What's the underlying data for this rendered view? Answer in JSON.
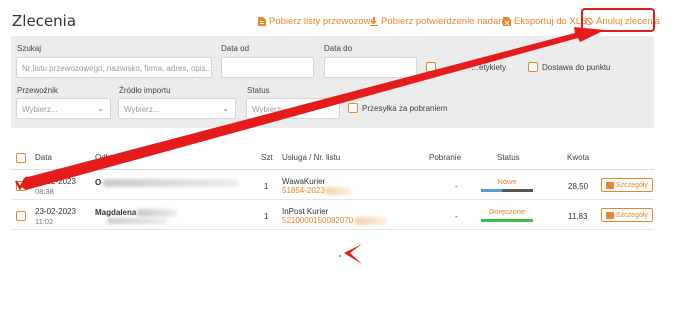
{
  "page": {
    "title": "Zlecenia"
  },
  "actions": [
    {
      "label": "Pobierz listy przewozowe",
      "icon": "file-pdf-icon"
    },
    {
      "label": "Pobierz potwierdzenie nadania",
      "icon": "download-icon"
    },
    {
      "label": "Eksportuj do XLS",
      "icon": "file-excel-icon"
    },
    {
      "label": "Anuluj zlecenia",
      "icon": "ban-icon"
    }
  ],
  "filters": {
    "search": {
      "label": "Szukaj",
      "placeholder": "Nr listu przewozowego, nazwisko, firma, adres, opis..."
    },
    "date_from": {
      "label": "Data od",
      "value": ""
    },
    "date_to": {
      "label": "Data do",
      "value": ""
    },
    "labels_checkbox": "…etykiety",
    "point_checkbox": "Dostawa do punktu",
    "carrier": {
      "label": "Przewoźnik",
      "placeholder": "Wybierz..."
    },
    "source": {
      "label": "Źródło importu",
      "placeholder": "Wybierz..."
    },
    "status": {
      "label": "Status",
      "placeholder": "Wybierz..."
    },
    "cod_checkbox": "Przesyłka za pobraniem"
  },
  "table": {
    "headers": {
      "date": "Data",
      "sender": "Odbiorca",
      "qty": "Szt",
      "service": "Usługa / Nr. listu",
      "cod": "Pobranie",
      "status": "Status",
      "amount": "Kwota"
    },
    "rows": [
      {
        "date": "24-02-2023",
        "time": "08:38",
        "name": "O",
        "qty": "1",
        "service": "WawaKurier",
        "tracking": "51854-2023",
        "cod": "-",
        "status": "Nowe",
        "amount": "28,50",
        "details": "Szczegóły"
      },
      {
        "date": "23-02-2023",
        "time": "11:02",
        "name": "Magdalena",
        "qty": "1",
        "service": "InPost Kurier",
        "tracking": "5210000150082070",
        "cod": "-",
        "status": "Doręczone",
        "amount": "11,83",
        "details": "Szczegóły"
      }
    ]
  },
  "colors": {
    "accent": "#e8862b",
    "annotation": "#e61c1c",
    "status_new_bar": "#5b9bd5",
    "status_done_bar": "#3cc04a"
  }
}
